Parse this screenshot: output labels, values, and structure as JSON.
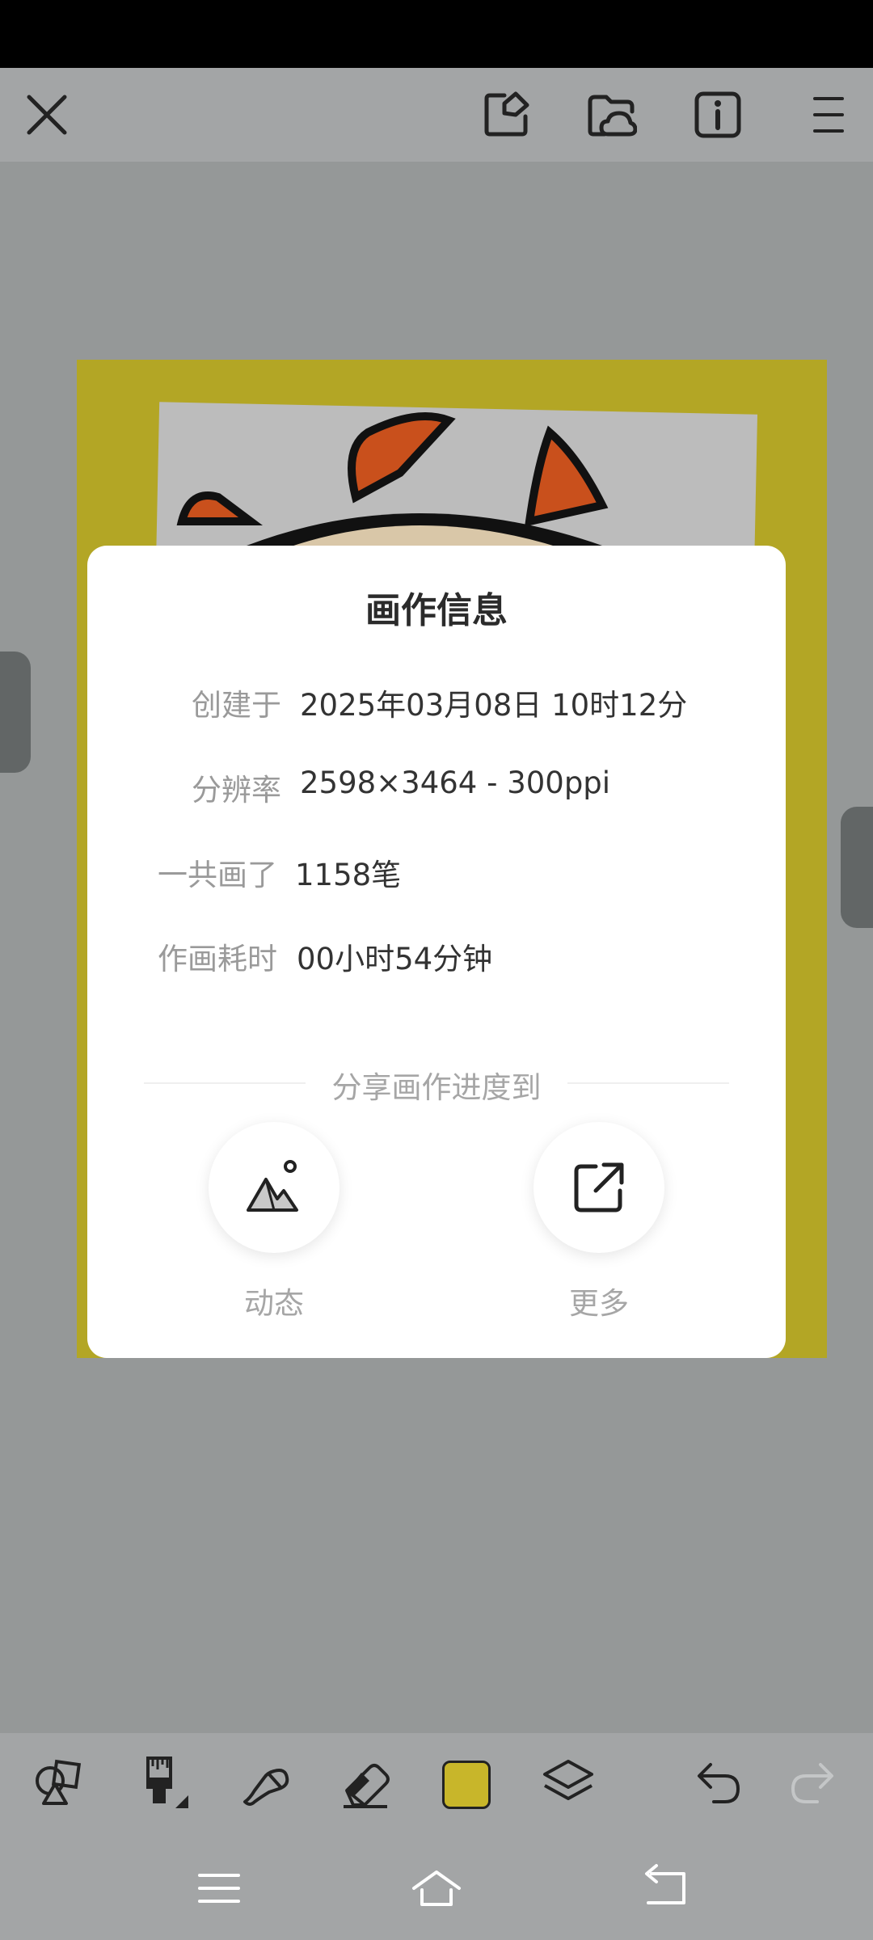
{
  "toolbar": {
    "icons": [
      "close-icon",
      "edit-note-icon",
      "cloud-folder-icon",
      "info-icon",
      "menu-icon"
    ]
  },
  "dialog": {
    "title": "画作信息",
    "rows": [
      {
        "label": "创建于",
        "value": "2025年03月08日 10时12分"
      },
      {
        "label": "分辨率",
        "value": "2598×3464 - 300ppi"
      },
      {
        "label": "一共画了",
        "value": "1158笔"
      },
      {
        "label": "作画耗时",
        "value": "00小时54分钟"
      }
    ],
    "share_heading": "分享画作进度到",
    "share_options": [
      {
        "label": "动态",
        "icon": "mountain-photo-icon"
      },
      {
        "label": "更多",
        "icon": "external-share-icon"
      }
    ]
  },
  "bottom_toolbar": {
    "current_color": "#c8b62a",
    "icons": [
      "shapes-icon",
      "brush-icon",
      "smudge-icon",
      "eraser-icon",
      "color-swatch",
      "layers-icon",
      "undo-icon",
      "redo-icon"
    ]
  },
  "colors": {
    "canvas_bg": "#959898",
    "artwork_bg": "#b3a625"
  },
  "nav": {
    "icons": [
      "menu-nav-icon",
      "home-nav-icon",
      "back-nav-icon"
    ]
  }
}
